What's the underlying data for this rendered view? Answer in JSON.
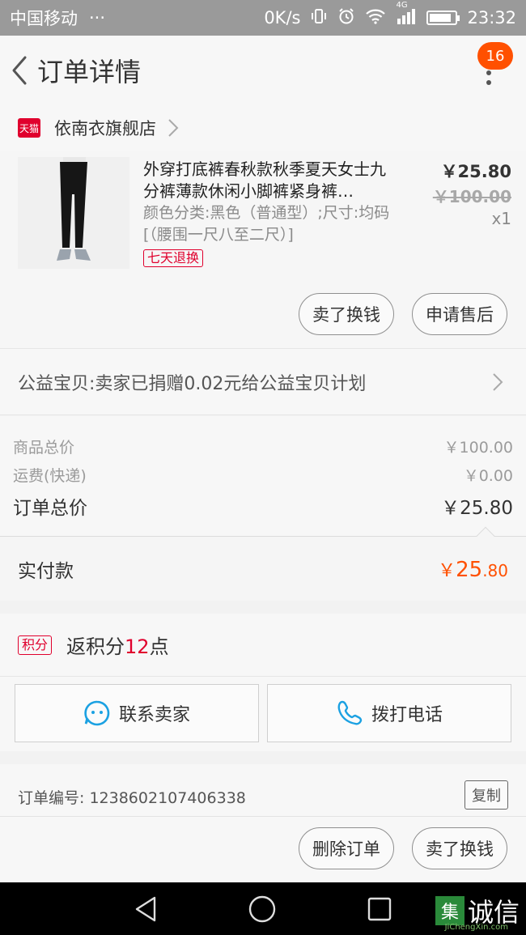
{
  "status_bar": {
    "carrier": "中国移动",
    "dots": "···",
    "speed": "0K/s",
    "network": "4G",
    "time": "23:32",
    "battery_level": 0.85
  },
  "nav": {
    "title": "订单详情",
    "badge_count": "16"
  },
  "shop": {
    "badge_text": "天猫",
    "name": "依南衣旗舰店"
  },
  "product": {
    "title": "外穿打底裤春秋款秋季夏天女士九分裤薄款休闲小脚裤紧身裤…",
    "attributes": "颜色分类:黑色（普通型）;尺寸:均码[（腰围一尺八至二尺）]",
    "tag": "七天退换",
    "price": "￥25.80",
    "original_price": "￥100.00",
    "quantity": "x1",
    "buttons": [
      "卖了换钱",
      "申请售后"
    ]
  },
  "charity": {
    "text": "公益宝贝:卖家已捐赠0.02元给公益宝贝计划"
  },
  "summary": {
    "rows": [
      {
        "label": "商品总价",
        "value": "￥100.00"
      },
      {
        "label": "运费(快递)",
        "value": "￥0.00"
      },
      {
        "label": "订单总价",
        "value": "￥25.80"
      }
    ]
  },
  "paid": {
    "label": "实付款",
    "symbol": "￥",
    "int": "25",
    "dec": ".80"
  },
  "points": {
    "tag": "积分",
    "prefix": "返积分",
    "number": "12",
    "suffix": "点"
  },
  "contact": {
    "seller": "联系卖家",
    "phone": "拨打电话"
  },
  "order": {
    "label": "订单编号:",
    "number": "1238602107406338",
    "copy": "复制",
    "buttons": [
      "删除订单",
      "卖了换钱"
    ]
  },
  "watermark": {
    "box": "集",
    "text": "诚信",
    "sub": "JiChengXin.com"
  },
  "colors": {
    "accent": "#ff5000",
    "tmall_red": "#e0002d",
    "status_bar": "#9a9a9a"
  }
}
